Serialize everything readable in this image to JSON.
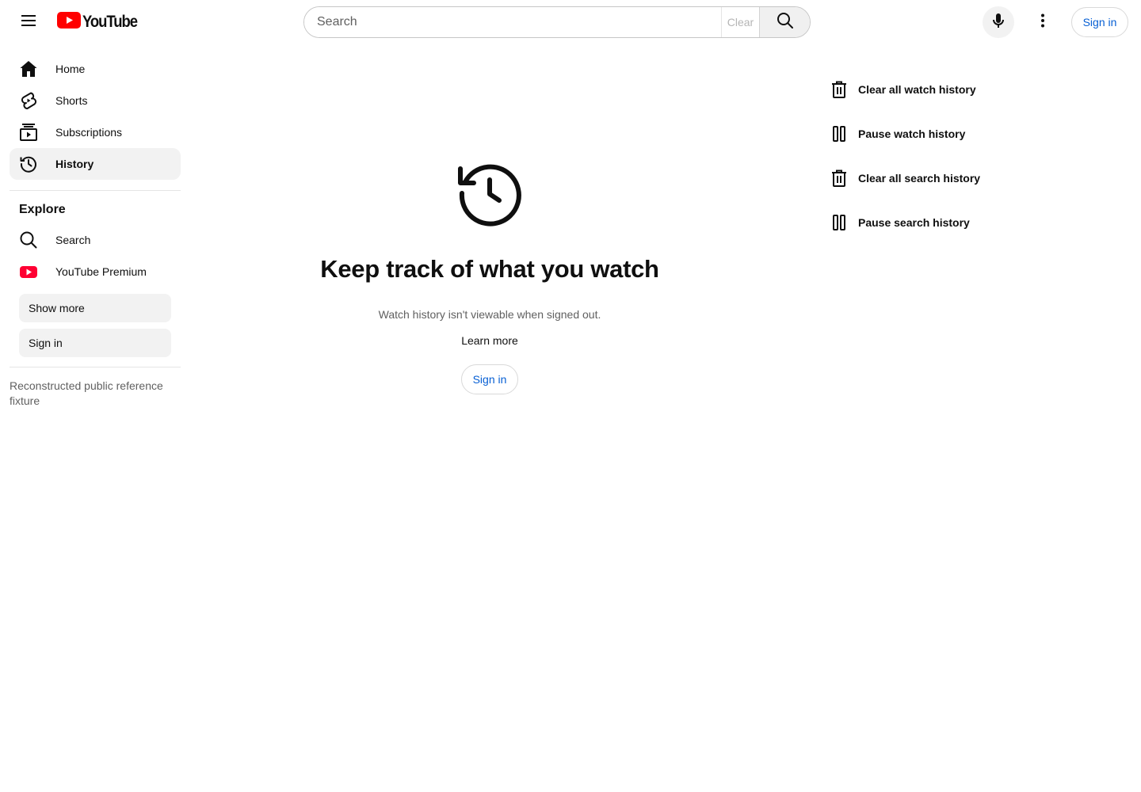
{
  "header": {
    "menu_icon": "hamburger-menu-icon",
    "logo_text": "YouTube",
    "brand_color": "#ff0000",
    "search_placeholder": "Search",
    "clear_label": "Clear",
    "search_icon": "search-icon",
    "mic_icon": "microphone-icon",
    "more_icon": "vertical-dots-icon",
    "signin_label": "Sign in"
  },
  "sidebar": {
    "items": [
      {
        "label": "Home",
        "icon": "home-icon"
      },
      {
        "label": "Shorts",
        "icon": "shorts-icon"
      },
      {
        "label": "Subscriptions",
        "icon": "subscriptions-icon"
      },
      {
        "label": "History",
        "icon": "history-icon",
        "active": true
      }
    ],
    "explore_title": "Explore",
    "explore_items": [
      {
        "label": "Search",
        "icon": "search-icon"
      },
      {
        "label": "YouTube Premium",
        "icon": "youtube-premium-icon"
      }
    ],
    "show_more_label": "Show more",
    "signin_label": "Sign in",
    "footer_note": "Reconstructed public reference fixture"
  },
  "main": {
    "icon": "history-icon",
    "title": "Keep track of what you watch",
    "subtitle": "Watch history isn't viewable when signed out.",
    "learn_more_label": "Learn more",
    "signin_label": "Sign in"
  },
  "actions": [
    {
      "label": "Clear all watch history",
      "icon": "trash-icon"
    },
    {
      "label": "Pause watch history",
      "icon": "pause-icon"
    },
    {
      "label": "Clear all search history",
      "icon": "trash-icon"
    },
    {
      "label": "Pause search history",
      "icon": "pause-icon"
    }
  ],
  "colors": {
    "link_blue": "#065fd4",
    "active_bg": "#f2f2f2",
    "secondary_text": "#606060"
  }
}
